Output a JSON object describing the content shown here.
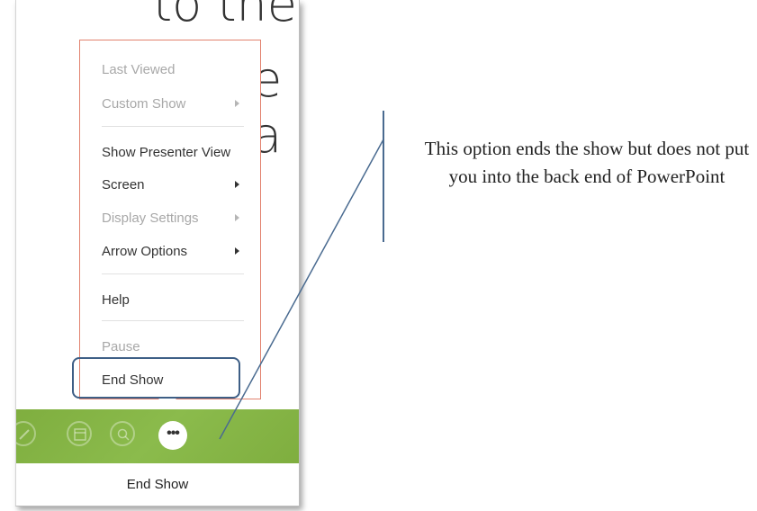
{
  "slide_background_text": [
    "to the",
    "e",
    "a"
  ],
  "menu": {
    "items": [
      {
        "label": "Last Viewed",
        "disabled": true
      },
      {
        "label": "Custom Show",
        "disabled": true,
        "submenu": true
      },
      {
        "label": "Show Presenter View",
        "disabled": false
      },
      {
        "label": "Screen",
        "disabled": false,
        "submenu": true
      },
      {
        "label": "Display Settings",
        "disabled": true,
        "submenu": true
      },
      {
        "label": "Arrow Options",
        "disabled": false,
        "submenu": true
      },
      {
        "label": "Help",
        "disabled": false
      },
      {
        "label": "Pause",
        "disabled": true
      },
      {
        "label": "End Show",
        "disabled": false
      }
    ]
  },
  "toolbar": {
    "buttons": [
      {
        "icon": "pen-icon"
      },
      {
        "icon": "slides-icon"
      },
      {
        "icon": "zoom-icon"
      },
      {
        "icon": "more-options-icon",
        "label": "•••"
      }
    ],
    "tooltip": "End Show"
  },
  "callout": {
    "text": "This option ends the show but does not put you into the back end of PowerPoint"
  },
  "colors": {
    "menu_border": "#e2826e",
    "highlight_border": "#3e5f86",
    "toolbar_green": "#8bbb4c",
    "annotation_line": "#4a6b90"
  }
}
